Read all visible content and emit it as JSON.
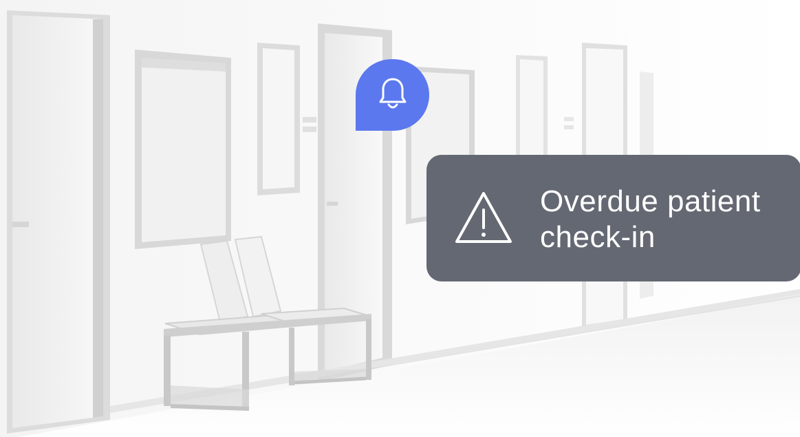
{
  "scene": {
    "description_icon": "bell-icon",
    "alert_icon": "warning-icon"
  },
  "alert": {
    "line1": "Overdue patient",
    "line2": "check-in"
  },
  "colors": {
    "accent": "#5b78ee",
    "toast_bg": "#646872",
    "toast_text": "#ffffff"
  }
}
